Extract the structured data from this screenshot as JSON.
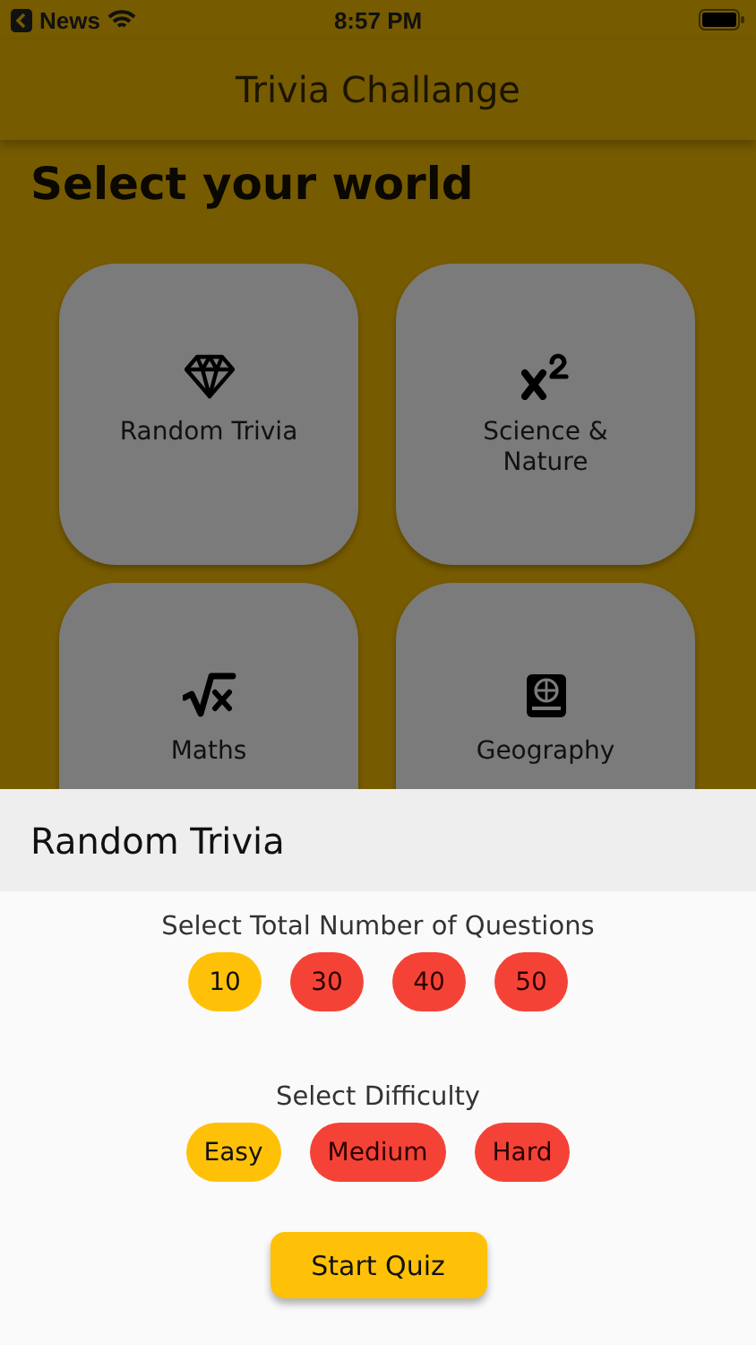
{
  "status_bar": {
    "back_label": "News",
    "time": "8:57 PM"
  },
  "app_bar": {
    "title": "Trivia Challange"
  },
  "heading": "Select your world",
  "worlds": [
    {
      "label": "Random Trivia",
      "kind": "diamond"
    },
    {
      "label": "Science & Nature",
      "kind": "power"
    },
    {
      "label": "Maths",
      "kind": "root"
    },
    {
      "label": "Geography",
      "kind": "atlas"
    }
  ],
  "sheet": {
    "title": "Random Trivia",
    "questions_label": "Select Total Number of Questions",
    "question_counts": [
      {
        "label": "10",
        "selected": true
      },
      {
        "label": "30",
        "selected": false
      },
      {
        "label": "40",
        "selected": false
      },
      {
        "label": "50",
        "selected": false
      }
    ],
    "difficulty_label": "Select Difficulty",
    "difficulties": [
      {
        "label": "Easy",
        "selected": true
      },
      {
        "label": "Medium",
        "selected": false
      },
      {
        "label": "Hard",
        "selected": false
      }
    ],
    "start_button": "Start Quiz"
  }
}
